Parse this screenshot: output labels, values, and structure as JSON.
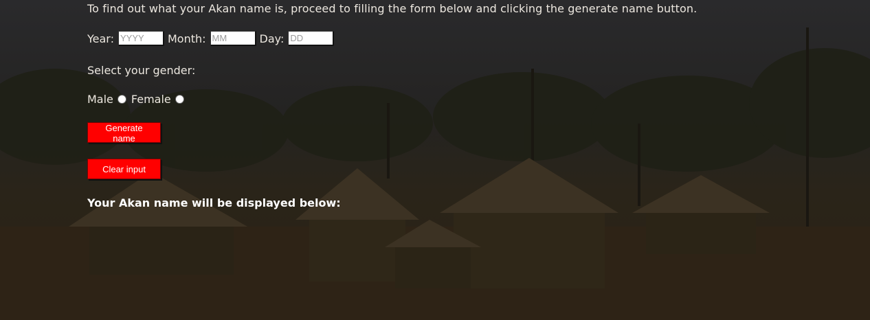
{
  "intro": "To find out what your Akan name is, proceed to filling the form below and clicking the generate name button.",
  "form": {
    "year_label": "Year:",
    "year_placeholder": "YYYY",
    "month_label": "Month:",
    "month_placeholder": "MM",
    "day_label": "Day:",
    "day_placeholder": "DD",
    "gender_prompt": "Select your gender:",
    "male_label": "Male",
    "female_label": "Female"
  },
  "buttons": {
    "generate": "Generate name",
    "clear": "Clear input"
  },
  "result_label": "Your Akan name will be displayed below:",
  "colors": {
    "button": "#ff0000",
    "text": "#ece7df"
  }
}
